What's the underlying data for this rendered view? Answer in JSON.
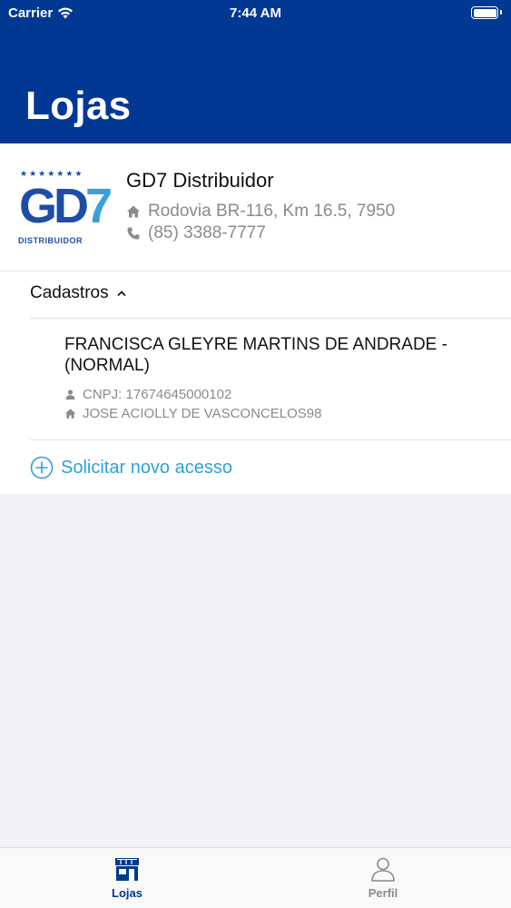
{
  "status_bar": {
    "carrier": "Carrier",
    "time": "7:44 AM"
  },
  "header": {
    "title": "Lojas"
  },
  "store": {
    "logo_stars": "★★★★★★★",
    "logo_letters": "GD",
    "logo_number": "7",
    "logo_caption": "DISTRIBUIDOR",
    "name": "GD7 Distribuidor",
    "address": "Rodovia BR-116, Km 16.5, 7950",
    "phone": "(85) 3388-7777"
  },
  "registrations": {
    "section_label": "Cadastros",
    "items": [
      {
        "name": "FRANCISCA GLEYRE MARTINS DE ANDRADE - (NORMAL)",
        "cnpj": "CNPJ: 17674645000102",
        "address": "JOSE ACIOLLY DE VASCONCELOS98"
      }
    ],
    "request_label": "Solicitar novo acesso"
  },
  "tabbar": {
    "tabs": [
      {
        "label": "Lojas",
        "active": true
      },
      {
        "label": "Perfil",
        "active": false
      }
    ]
  },
  "colors": {
    "brand": "#003893",
    "accent": "#2f9fda",
    "muted": "#8a8a8f"
  }
}
